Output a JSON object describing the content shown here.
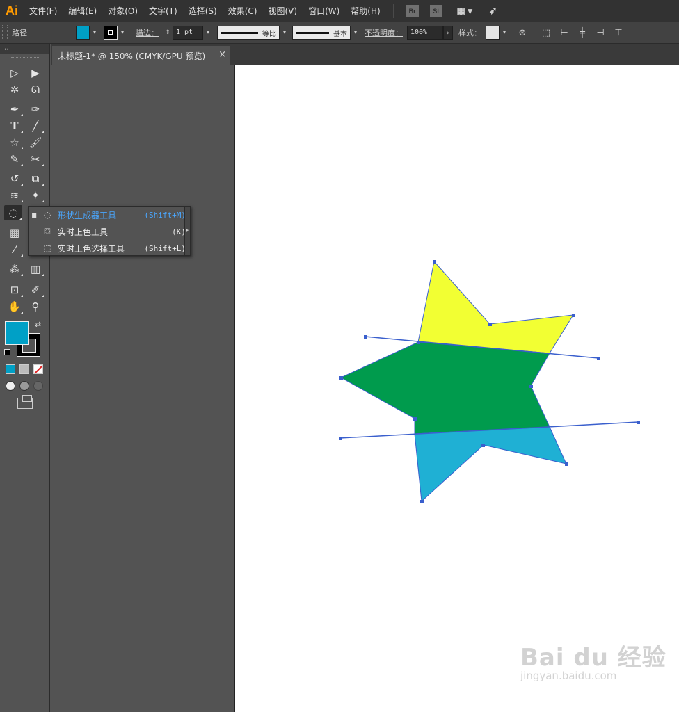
{
  "app": {
    "logo": "Ai"
  },
  "menu": [
    "文件(F)",
    "编辑(E)",
    "对象(O)",
    "文字(T)",
    "选择(S)",
    "效果(C)",
    "视图(V)",
    "窗口(W)",
    "帮助(H)"
  ],
  "menubar_icons": {
    "bridge": "Br",
    "stock": "St",
    "workspace": "workspace-icon",
    "rocket": "rocket-icon"
  },
  "control_bar": {
    "selection_label": "路径",
    "fill_color": "#00a0c6",
    "stroke_label": "描边：",
    "stroke_weight": "1 pt",
    "variable_width": "等比",
    "brush": "基本",
    "opacity_label": "不透明度：",
    "opacity_value": "100%",
    "style_label": "样式："
  },
  "document_tab": {
    "title": "未标题-1* @ 150% (CMYK/GPU 预览)",
    "close": "×"
  },
  "toolbox": {
    "collapse": "‹‹",
    "fill_color": "#00a0c6",
    "stroke_color": "#000000"
  },
  "flyout": {
    "items": [
      {
        "label": "形状生成器工具",
        "shortcut": "(Shift+M)",
        "selected": true
      },
      {
        "label": "实时上色工具",
        "shortcut": "(K)",
        "selected": false
      },
      {
        "label": "实时上色选择工具",
        "shortcut": "(Shift+L)",
        "selected": false
      }
    ]
  },
  "artwork": {
    "colors": {
      "top_region": "#f2ff33",
      "middle_region": "#009b4d",
      "bottom_region": "#1fb0d4",
      "path_stroke": "#3a5fcd"
    }
  },
  "watermark": {
    "brand": "Bai du 经验",
    "url": "jingyan.baidu.com"
  }
}
